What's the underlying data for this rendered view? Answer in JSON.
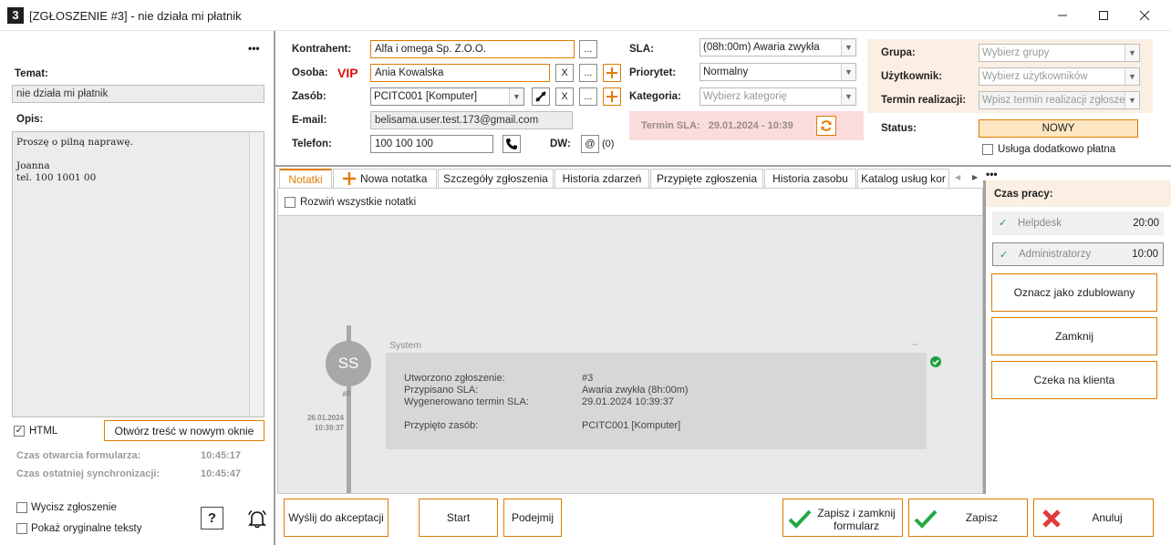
{
  "window": {
    "title": "[ZGŁOSZENIE #3] - nie działa mi płatnik",
    "logo": "3"
  },
  "left": {
    "more": "•••",
    "topic_label": "Temat:",
    "topic_value": "nie działa mi płatnik",
    "desc_label": "Opis:",
    "desc_lines": [
      "Proszę o pilną naprawę.",
      "",
      "Joanna",
      "tel. 100 1001 00"
    ],
    "html_label": "HTML",
    "open_new_window": "Otwórz treść w nowym oknie",
    "open_time_label": "Czas otwarcia formularza:",
    "open_time_value": "10:45:17",
    "sync_time_label": "Czas ostatniej synchronizacji:",
    "sync_time_value": "10:45:47",
    "mute_label": "Wycisz zgłoszenie",
    "original_label": "Pokaż oryginalne teksty",
    "help": "?"
  },
  "form": {
    "contractor_label": "Kontrahent:",
    "contractor_value": "Alfa i omega Sp. Z.O.O.",
    "person_label": "Osoba:",
    "vip": "VIP",
    "person_value": "Ania Kowalska",
    "resource_label": "Zasób:",
    "resource_value": "PCITC001 [Komputer]",
    "email_label": "E-mail:",
    "email_value": "belisama.user.test.173@gmail.com",
    "phone_label": "Telefon:",
    "phone_value": "100 100 100",
    "dw_label": "DW:",
    "dw_count": "(0)",
    "dots": "...",
    "x": "X",
    "sla_label": "SLA:",
    "sla_value": "(08h:00m) Awaria zwykła",
    "priority_label": "Priorytet:",
    "priority_value": "Normalny",
    "category_label": "Kategoria:",
    "category_placeholder": "Wybierz kategorię",
    "sla_term": "Termin SLA:   29.01.2024 - 10:39",
    "group_label": "Grupa:",
    "group_placeholder": "Wybierz grupy",
    "user_label": "Użytkownik:",
    "user_placeholder": "Wybierz użytkowników",
    "term_label": "Termin realizacji:",
    "term_placeholder": "Wpisz termin realizacji zgłosze",
    "status_label": "Status:",
    "status_value": "NOWY",
    "paid_label": "Usługa dodatkowo płatna"
  },
  "tabs": [
    "Notatki",
    "Nowa notatka",
    "Szczegóły zgłoszenia",
    "Historia zdarzeń",
    "Przypięte zgłoszenia",
    "Historia zasobu",
    "Katalog usług kor"
  ],
  "notes": {
    "expand_label": "Rozwiń wszystkie notatki",
    "avatar": "SS",
    "number": "#6",
    "date": "26.01.2024",
    "time": "10:39:37",
    "author": "System",
    "corner": "--",
    "rows": [
      {
        "k": "Utworzono zgłoszenie:",
        "v": "#3"
      },
      {
        "k": "Przypisano SLA:",
        "v": "Awaria zwykła (8h:00m)"
      },
      {
        "k": "Wygenerowano termin SLA:",
        "v": "29.01.2024 10:39:37"
      },
      {
        "k": "Przypięto zasób:",
        "v": "PCITC001 [Komputer]"
      }
    ]
  },
  "right": {
    "work_time_label": "Czas pracy:",
    "helpdesk": "Helpdesk",
    "helpdesk_time": "20:00",
    "admins": "Administratorzy",
    "admins_time": "10:00",
    "mark_dup": "Oznacz jako zdublowany",
    "close": "Zamknij",
    "wait": "Czeka na klienta"
  },
  "bottom": {
    "send": "Wyślij do akceptacji",
    "start": "Start",
    "take": "Podejmij",
    "save_close": "Zapisz i zamknij formularz",
    "save": "Zapisz",
    "cancel": "Anuluj"
  },
  "colors": {
    "accent": "#e07b00",
    "sla_bg": "#fadcdc",
    "status_bg": "#fde5c2",
    "right_top_bg": "#fbeee2",
    "note_bg": "#e3e3e3",
    "timeline": "#a8a8a8"
  }
}
